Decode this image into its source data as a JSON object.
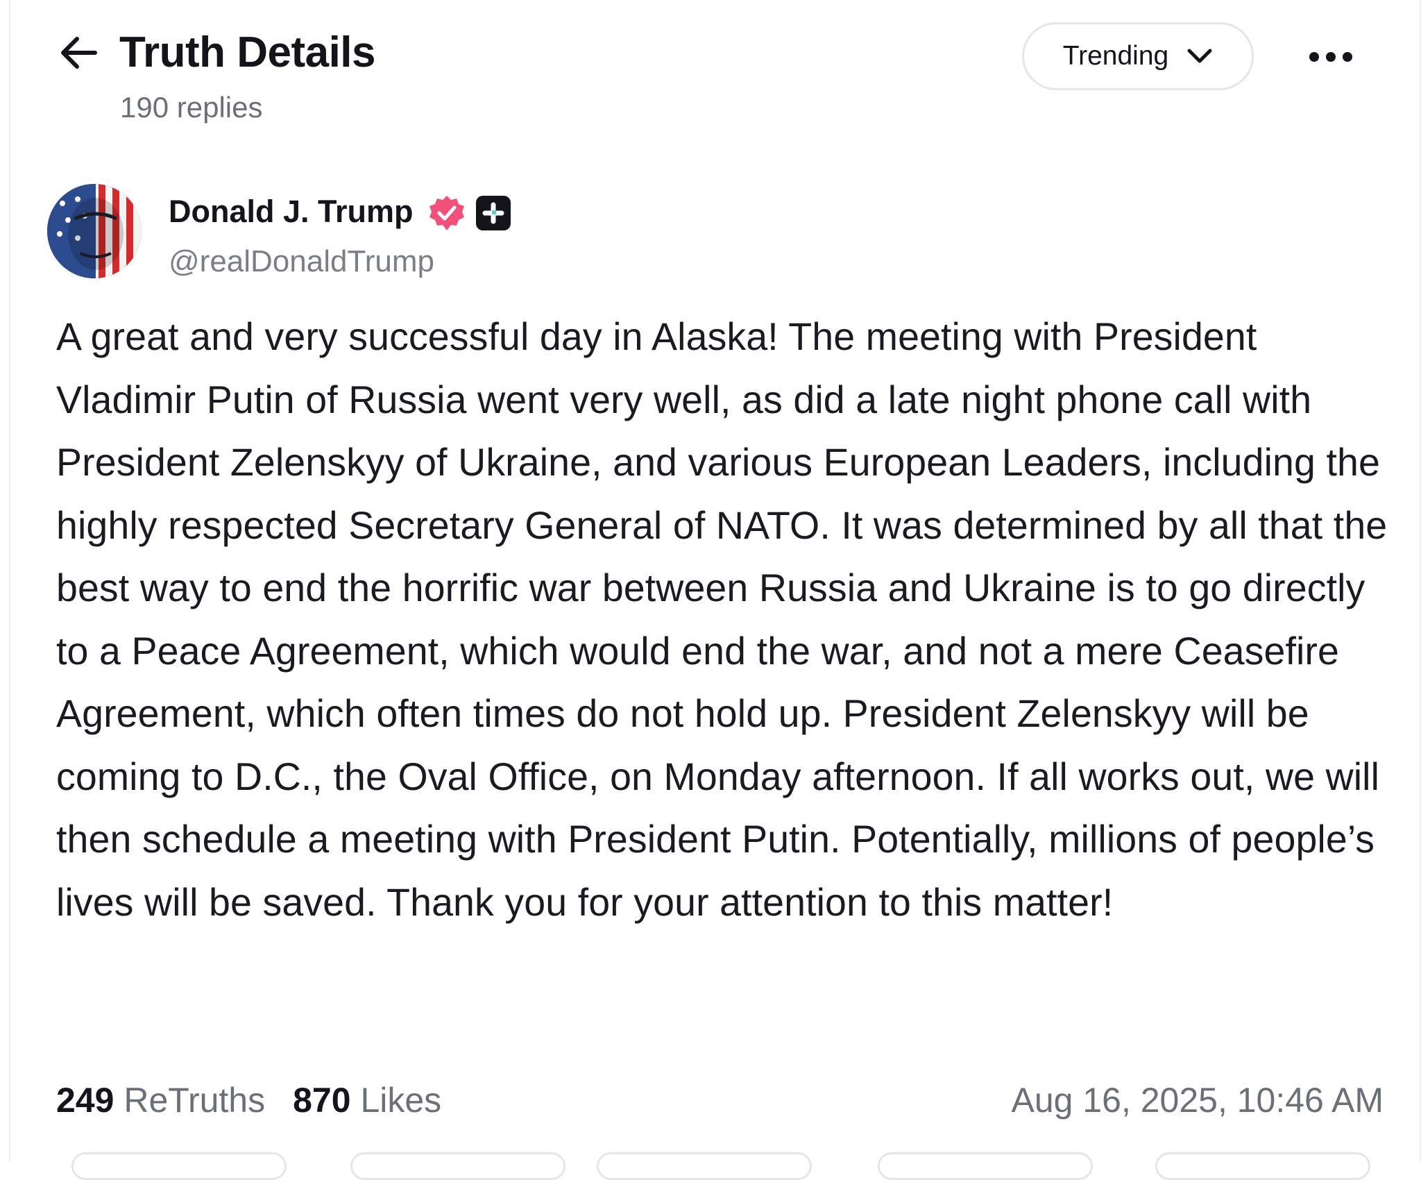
{
  "header": {
    "title": "Truth Details",
    "reply_count": "190 replies",
    "sort_label": "Trending"
  },
  "author": {
    "name": "Donald J. Trump",
    "handle": "@realDonaldTrump"
  },
  "post": {
    "text": "A great and very successful day in Alaska! The meeting with President Vladimir Putin of Russia went very well, as did a late night phone call with President Zelenskyy of Ukraine, and various European Leaders, including the highly respected Secretary General of NATO. It was determined by all that the best way to end the horrific war between Russia and Ukraine is to go directly to a Peace Agreement, which would end the war, and not a mere Ceasefire Agreement, which often times do not hold up. President Zelenskyy will be coming to D.C., the Oval Office, on Monday afternoon. If all works out, we will then schedule a meeting with President Putin. Potentially, millions of people’s lives will be saved. Thank you for your attention to this matter!"
  },
  "stats": {
    "retruths_count": "249",
    "retruths_label": "ReTruths",
    "likes_count": "870",
    "likes_label": "Likes",
    "timestamp": "Aug 16, 2025, 10:46 AM"
  },
  "colors": {
    "verified_badge": "#f0507a",
    "text_primary": "#14151a",
    "text_secondary": "#6b6f78",
    "border": "#e4e6ea"
  },
  "icons": {
    "back": "arrow-left-icon",
    "sort": "chevron-down-icon",
    "more": "more-horizontal-icon",
    "verified": "verified-badge-icon",
    "plus": "plus-square-icon"
  }
}
